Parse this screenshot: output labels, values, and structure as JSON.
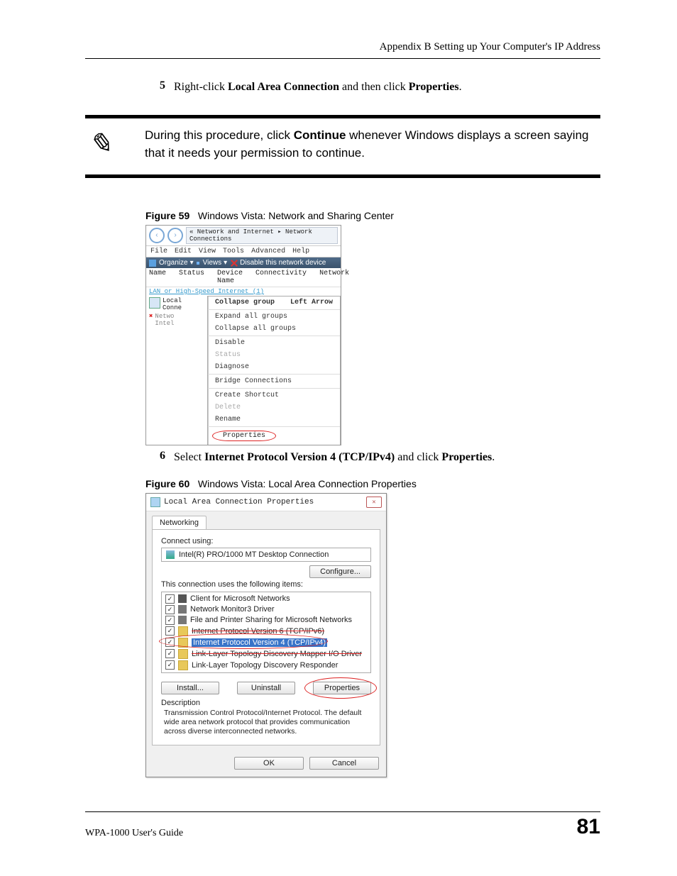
{
  "header": {
    "appendix": "Appendix B Setting up Your Computer's IP Address"
  },
  "step5": {
    "num": "5",
    "pre": "Right-click ",
    "b1": "Local Area Connection",
    "mid": " and then click ",
    "b2": "Properties",
    "post": "."
  },
  "note": {
    "pre": "During this procedure, click ",
    "bold": "Continue",
    "post": " whenever Windows displays a screen saying that it needs your permission to continue."
  },
  "fig59": {
    "label": "Figure 59",
    "caption": "Windows Vista: Network and Sharing Center"
  },
  "shot1": {
    "addr": "« Network and Internet  ▸  Network Connections",
    "menus": [
      "File",
      "Edit",
      "View",
      "Tools",
      "Advanced",
      "Help"
    ],
    "toolbar": {
      "organize": "Organize",
      "views": "Views",
      "disable": "Disable this network device"
    },
    "cols": [
      "Name",
      "Status",
      "Device Name",
      "Connectivity",
      "Network"
    ],
    "group": "LAN or High-Speed Internet (1)",
    "left_lines": [
      "Local",
      "Conne",
      "Netwo",
      "Intel"
    ],
    "ctx": {
      "collapse_group": "Collapse group",
      "la": "Left Arrow",
      "expand": "Expand all groups",
      "collapse_all": "Collapse all groups",
      "disable": "Disable",
      "status": "Status",
      "diagnose": "Diagnose",
      "bridge": "Bridge Connections",
      "shortcut": "Create Shortcut",
      "delete": "Delete",
      "rename": "Rename",
      "properties": "Properties"
    }
  },
  "step6": {
    "num": "6",
    "pre": "Select ",
    "b1": "Internet Protocol Version 4 (TCP/IPv4)",
    "mid": " and click ",
    "b2": "Properties",
    "post": "."
  },
  "fig60": {
    "label": "Figure 60",
    "caption": "Windows Vista: Local Area Connection Properties"
  },
  "shot2": {
    "title": "Local Area Connection Properties",
    "tab": "Networking",
    "connect_using": "Connect using:",
    "adapter": "Intel(R) PRO/1000 MT Desktop Connection",
    "configure": "Configure...",
    "uses_label": "This connection uses the following items:",
    "items": [
      "Client for Microsoft Networks",
      "Network Monitor3 Driver",
      "File and Printer Sharing for Microsoft Networks",
      "Internet Protocol Version 6 (TCP/IPv6)",
      "Internet Protocol Version 4 (TCP/IPv4)",
      "Link-Layer Topology Discovery Mapper I/O Driver",
      "Link-Layer Topology Discovery Responder"
    ],
    "install": "Install...",
    "uninstall": "Uninstall",
    "properties": "Properties",
    "description_label": "Description",
    "description": "Transmission Control Protocol/Internet Protocol. The default wide area network protocol that provides communication across diverse interconnected networks.",
    "ok": "OK",
    "cancel": "Cancel"
  },
  "footer": {
    "guide": "WPA-1000 User's Guide",
    "page": "81"
  }
}
